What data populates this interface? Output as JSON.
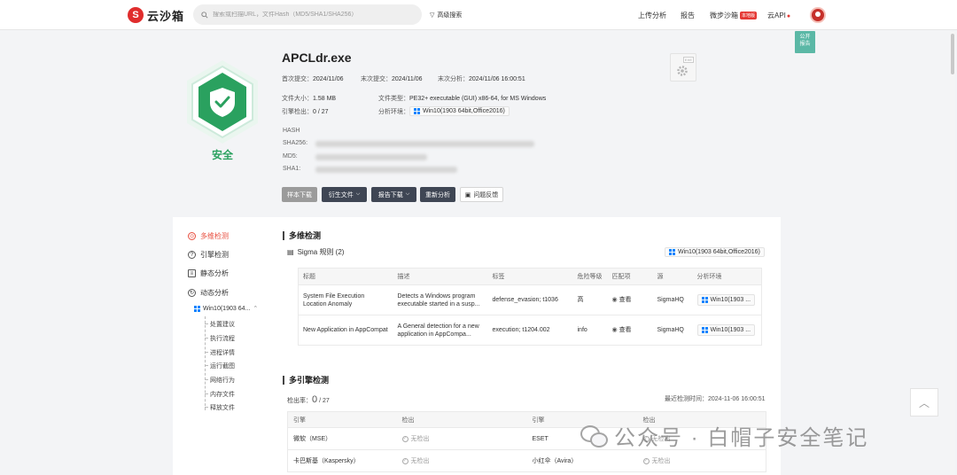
{
  "app": {
    "logo_mark": "S",
    "logo_text": "云沙箱"
  },
  "search": {
    "placeholder": "搜索或扫描URL，文件Hash（MD5/SHA1/SHA256）"
  },
  "topnav": {
    "advanced_search": "高级搜索",
    "upload": "上传分析",
    "report": "报告",
    "weibu_sandbox": "微步沙箱",
    "local_badge": "本地版",
    "cloud_api": "云API",
    "public_report": [
      "公开",
      "报告"
    ]
  },
  "verdict": {
    "label": "安全",
    "color": "#2aa15f"
  },
  "file": {
    "name": "APCLdr.exe",
    "first_submit_label": "首次提交：",
    "first_submit": "2024/11/06",
    "last_submit_label": "末次提交：",
    "last_submit": "2024/11/06",
    "last_analysis_label": "末次分析：",
    "last_analysis": "2024/11/06 16:00:51",
    "size_label": "文件大小：",
    "size": "1.58 MB",
    "type_label": "文件类型：",
    "type": "PE32+ executable (GUI) x86-64, for MS Windows",
    "engine_label": "引擎检出：",
    "engine": "0 / 27",
    "env_label": "分析环境：",
    "env": "Win10(1903 64bit,Office2016)",
    "icon_tag": "EXE"
  },
  "hash": {
    "title": "HASH",
    "sha256_label": "SHA256:",
    "md5_label": "MD5:",
    "sha1_label": "SHA1:"
  },
  "actions": {
    "sample_download": "样本下载",
    "derived_files": "衍生文件",
    "report_download": "报告下载",
    "reanalyze": "重新分析",
    "feedback": "问题反馈"
  },
  "sidebar": {
    "items": [
      {
        "label": "多维检测",
        "active": true
      },
      {
        "label": "引擎检测"
      },
      {
        "label": "静态分析"
      },
      {
        "label": "动态分析"
      }
    ],
    "env": "Win10(1903 64...",
    "sub_items": [
      "处置建议",
      "执行流程",
      "进程详情",
      "运行截图",
      "网络行为",
      "内存文件",
      "释放文件"
    ]
  },
  "multi": {
    "title": "多维检测",
    "sigma_title": "Sigma 规则 (2)",
    "env": "Win10(1903 64bit,Office2016)",
    "headers": [
      "标题",
      "描述",
      "标签",
      "危险等级",
      "匹配项",
      "源",
      "分析环境"
    ],
    "rows": [
      {
        "title": "System File Execution Location Anomaly",
        "desc": "Detects a Windows program executable started in a susp...",
        "tags": "defense_evasion; t1036",
        "level": "高",
        "match": "查看",
        "source": "SigmaHQ",
        "env": "Win10(1903 ..."
      },
      {
        "title": "New Application in AppCompat",
        "desc": "A General detection for a new application in AppCompa...",
        "tags": "execution; t1204.002",
        "level": "info",
        "match": "查看",
        "source": "SigmaHQ",
        "env": "Win10(1903 ..."
      }
    ]
  },
  "engines": {
    "title": "多引擎检测",
    "rate_label": "检出率：",
    "rate_value": "0",
    "rate_total": "/ 27",
    "last_time_label": "最近检测时间：",
    "last_time": "2024-11-06 16:00:51",
    "headers": [
      "引擎",
      "检出",
      "引擎",
      "检出"
    ],
    "rows": [
      [
        "微软（MSE）",
        "无检出",
        "ESET",
        "无检出"
      ],
      [
        "卡巴斯基（Kaspersky）",
        "无检出",
        "小红伞（Avira）",
        "无检出"
      ]
    ]
  },
  "watermark": "公众号 · 白帽子安全笔记"
}
